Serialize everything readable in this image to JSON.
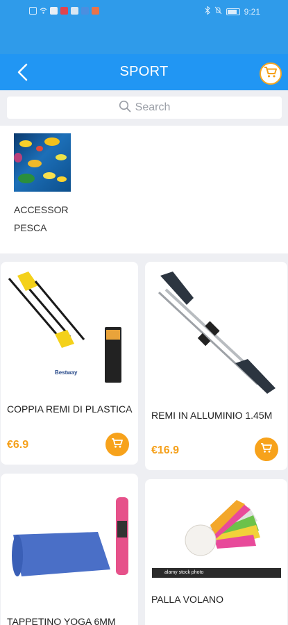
{
  "status_bar": {
    "time": "9:21",
    "icons": [
      "sim-icon",
      "wifi-icon",
      "app-icon-1",
      "app-icon-2",
      "app-icon-3",
      "app-icon-4",
      "bluetooth-icon",
      "mute-icon",
      "battery-icon"
    ]
  },
  "header": {
    "title": "SPORT",
    "back_icon": "back-arrow-icon",
    "cart_icon": "cart-icon"
  },
  "search": {
    "placeholder": "Search"
  },
  "category": {
    "label": "ACCESSOR PESCA"
  },
  "products": [
    {
      "name": "COPPIA REMI DI PLASTICA",
      "price": "€6.9",
      "brand_text": "Bestway"
    },
    {
      "name": "REMI IN ALLUMINIO 1.45M",
      "price": "€16.9"
    },
    {
      "name": "TAPPETINO YOGA 6MM"
    },
    {
      "name": "PALLA VOLANO",
      "watermark": "alamy stock photo"
    }
  ],
  "colors": {
    "appbar": "#2196f3",
    "statusbar": "#2f9bea",
    "price": "#f5a01a",
    "cart_button": "#f7a21b",
    "background": "#eeeff3"
  }
}
